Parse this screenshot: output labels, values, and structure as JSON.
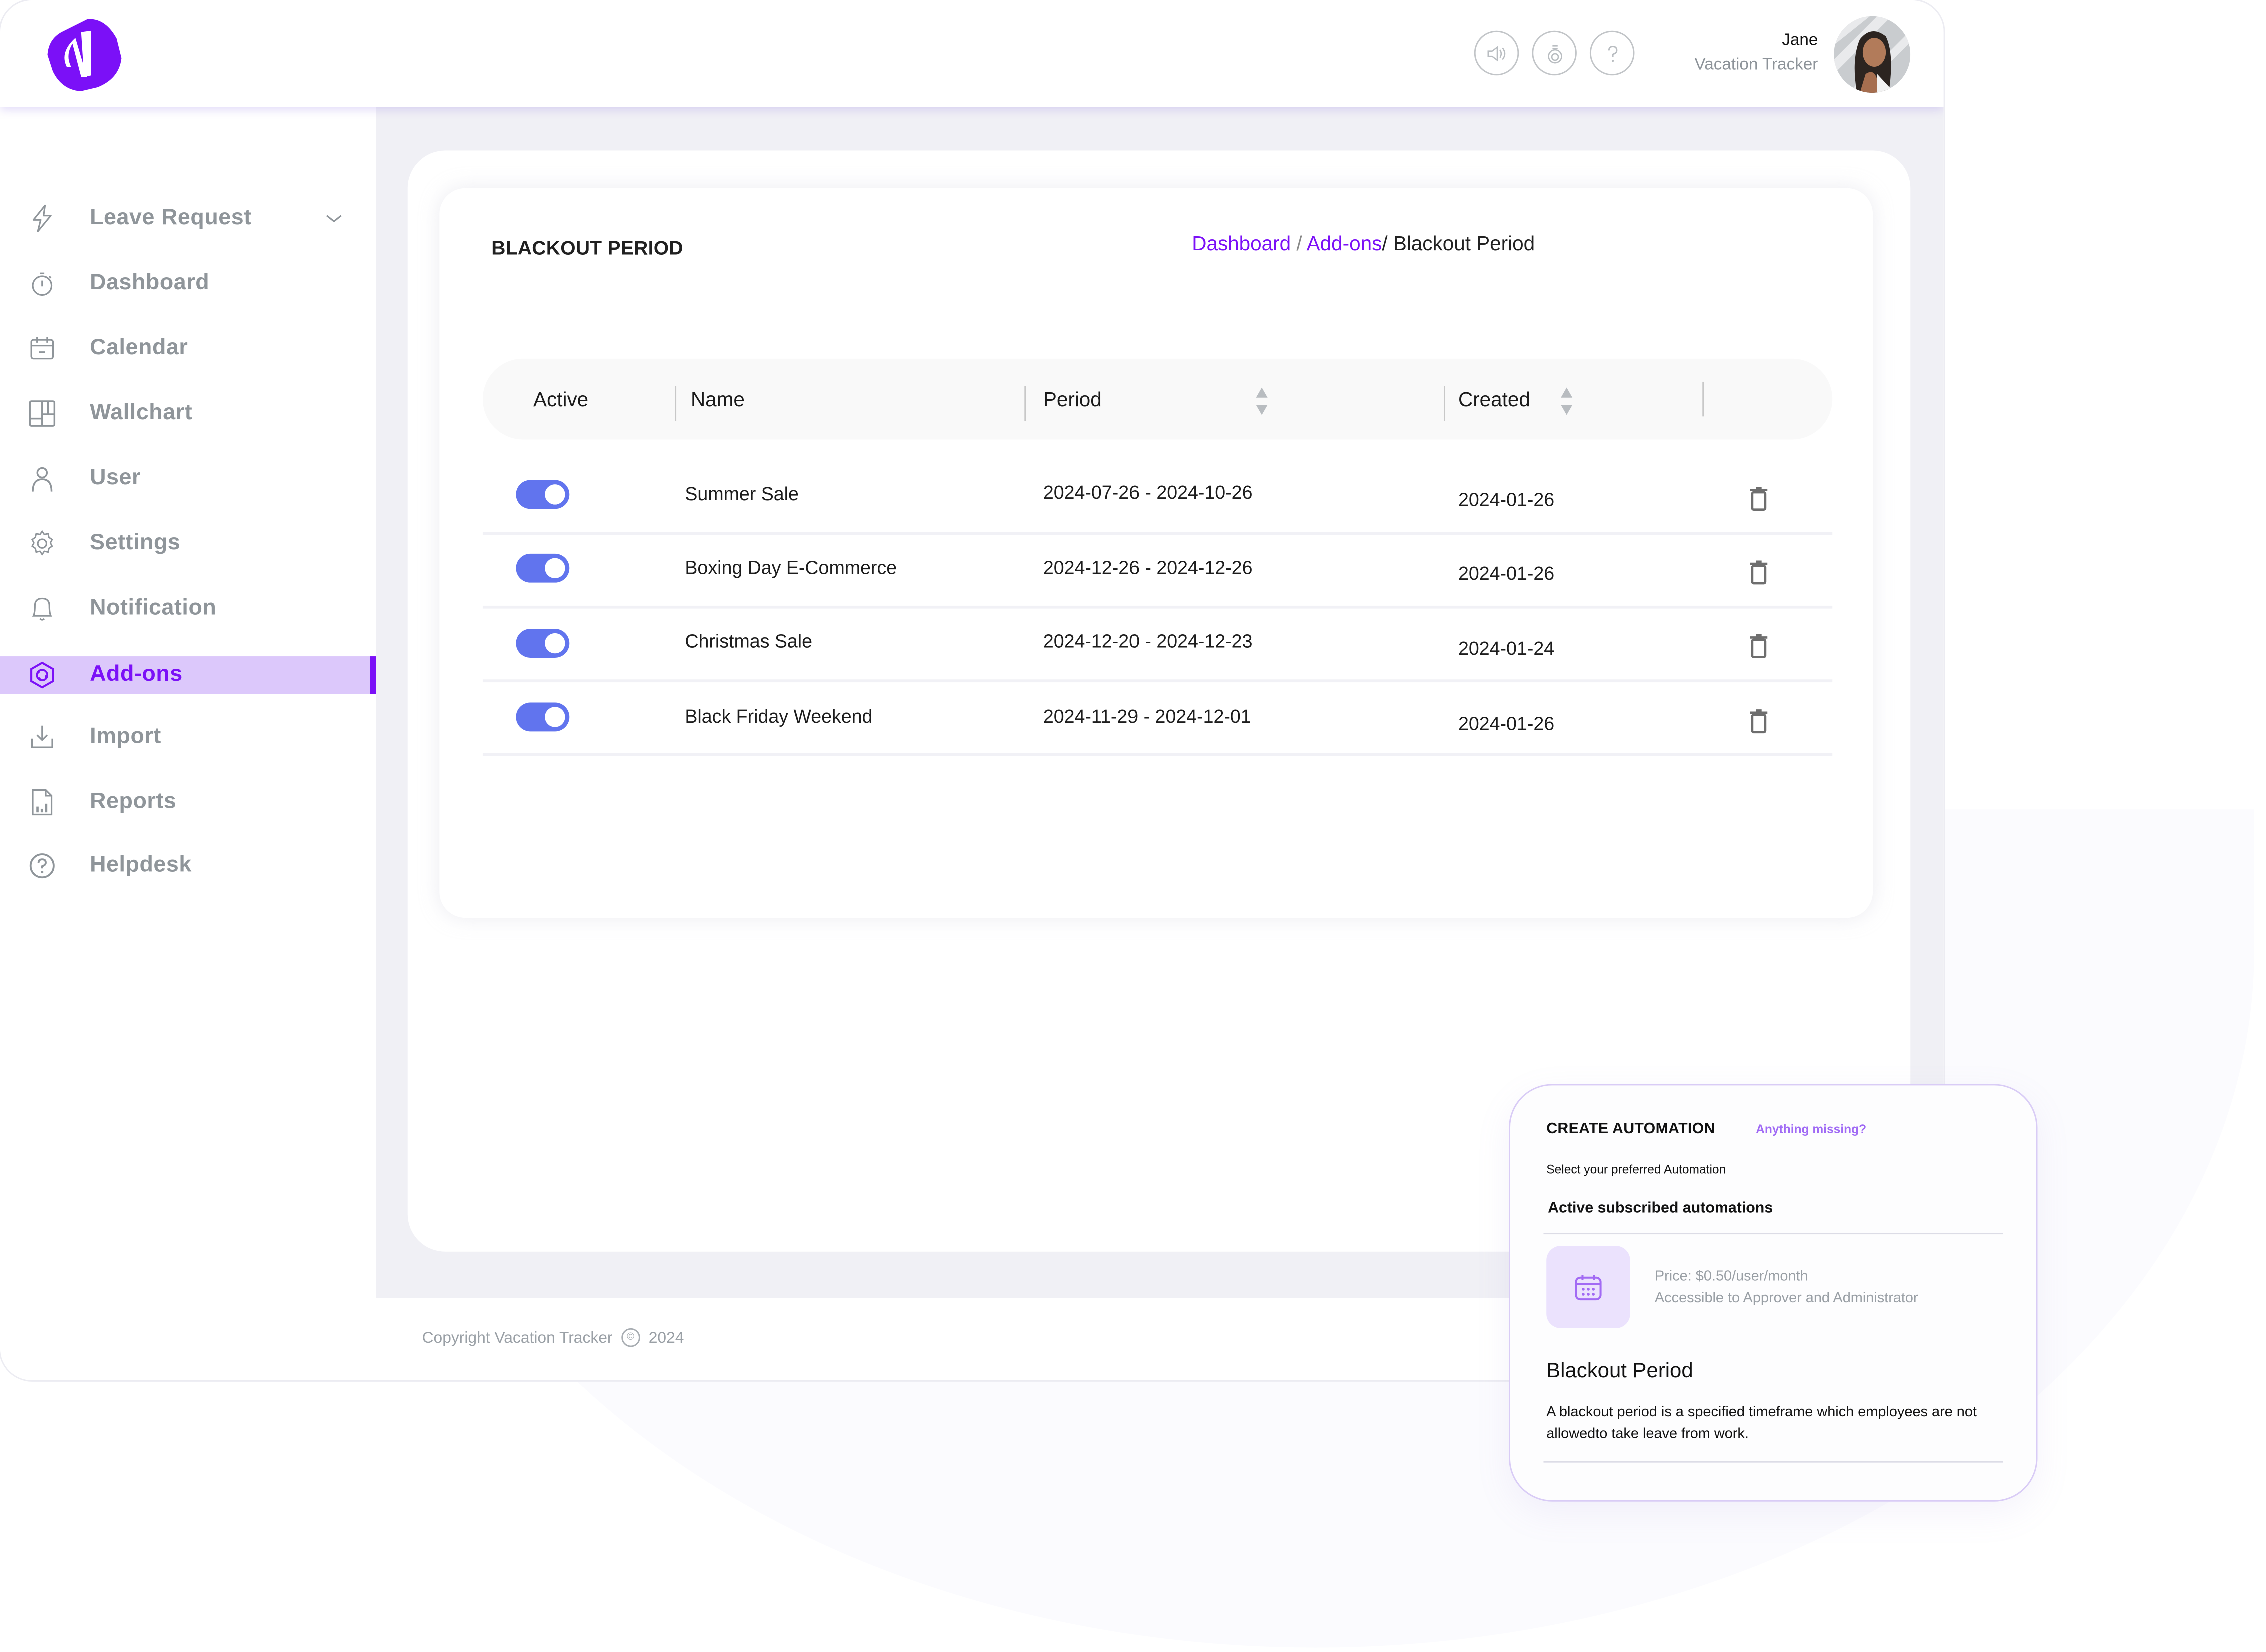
{
  "app": {
    "brand_color": "#7b10f7",
    "header_icons": [
      {
        "name": "announcement-icon"
      },
      {
        "name": "gift-icon"
      },
      {
        "name": "help-icon"
      }
    ],
    "user": {
      "name": "Jane",
      "org": "Vacation Tracker"
    }
  },
  "sidebar": {
    "items": [
      {
        "label": "Leave Request",
        "icon": "lightning-icon",
        "expandable": true
      },
      {
        "label": "Dashboard",
        "icon": "stopwatch-icon"
      },
      {
        "label": "Calendar",
        "icon": "calendar-icon"
      },
      {
        "label": "Wallchart",
        "icon": "wallchart-icon"
      },
      {
        "label": "User",
        "icon": "user-icon"
      },
      {
        "label": "Settings",
        "icon": "gear-icon"
      },
      {
        "label": "Notification",
        "icon": "bell-icon"
      },
      {
        "label": "Add-ons",
        "icon": "addons-hexagon-icon",
        "active": true
      },
      {
        "label": "Import",
        "icon": "import-icon"
      },
      {
        "label": "Reports",
        "icon": "report-icon"
      },
      {
        "label": "Helpdesk",
        "icon": "help-circle-icon"
      }
    ]
  },
  "page": {
    "title": "BLACKOUT PERIOD",
    "breadcrumb": {
      "items": [
        "Dashboard",
        "Add-ons"
      ],
      "separator": "/",
      "current": "Blackout Period"
    }
  },
  "table": {
    "columns": [
      "Active",
      "Name",
      "Period",
      "Created"
    ],
    "rows": [
      {
        "active": true,
        "name": "Summer Sale",
        "period": "2024-07-26 - 2024-10-26",
        "created": "2024-01-26"
      },
      {
        "active": true,
        "name": "Boxing Day E-Commerce",
        "period": "2024-12-26 - 2024-12-26",
        "created": "2024-01-26"
      },
      {
        "active": true,
        "name": "Christmas Sale",
        "period": "2024-12-20 - 2024-12-23",
        "created": "2024-01-24"
      },
      {
        "active": true,
        "name": "Black Friday Weekend",
        "period": "2024-11-29 - 2024-12-01",
        "created": "2024-01-26"
      }
    ],
    "toggle_color": "#6174ee"
  },
  "footer": {
    "text": "Copyright Vacation Tracker",
    "symbol": "©",
    "year": "2024"
  },
  "automation_card": {
    "title": "CREATE AUTOMATION",
    "link": "Anything missing?",
    "subtitle": "Select your preferred Automation",
    "section": "Active subscribed automations",
    "price": "Price: $0.50/user/month",
    "access": "Accessible to Approver and Administrator",
    "name": "Blackout Period",
    "description": "A blackout period is a specified timeframe which employees are not allowedto take leave from work."
  }
}
